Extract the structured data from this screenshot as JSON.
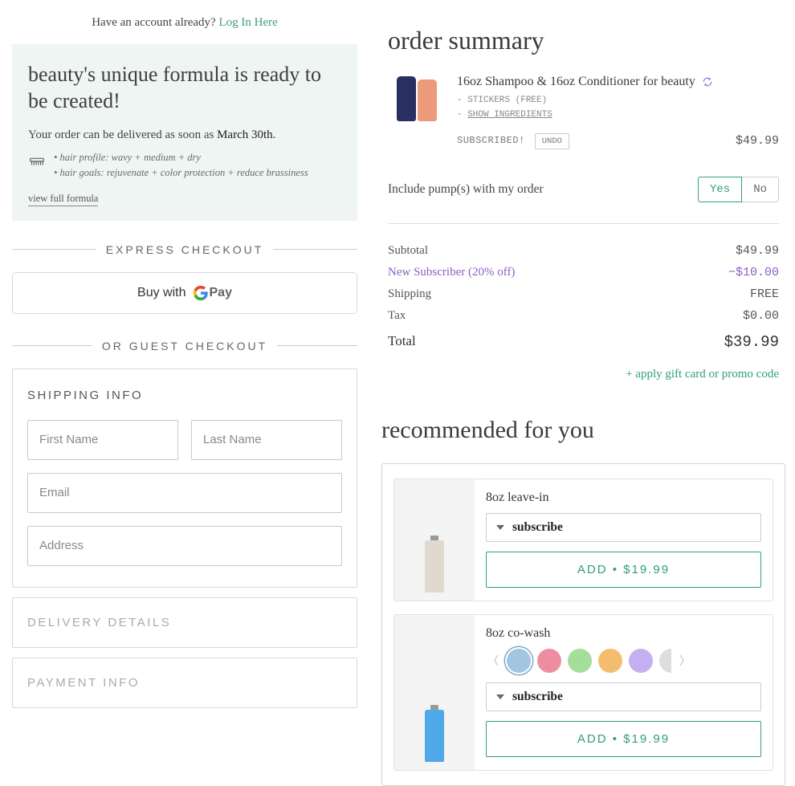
{
  "login": {
    "prompt": "Have an account already? ",
    "link": "Log In Here"
  },
  "formula": {
    "title": "beauty's unique formula is ready to be created!",
    "delivery_prefix": "Your order can be delivered as soon as ",
    "delivery_date": "March 30th",
    "delivery_suffix": ".",
    "profile_line": "• hair profile: wavy + medium + dry",
    "goals_line": "• hair goals: rejuvenate + color protection + reduce brassiness",
    "view_link": "view full formula"
  },
  "express": {
    "heading": "EXPRESS CHECKOUT",
    "buy_with": "Buy with ",
    "gpay": "Pay"
  },
  "guest": {
    "heading": "OR GUEST CHECKOUT"
  },
  "shipping": {
    "title": "SHIPPING INFO",
    "first_name_ph": "First Name",
    "last_name_ph": "Last Name",
    "email_ph": "Email",
    "address_ph": "Address"
  },
  "delivery_section": "DELIVERY DETAILS",
  "payment_section": "PAYMENT INFO",
  "order": {
    "title": "order summary",
    "product_name": "16oz Shampoo & 16oz Conditioner for beauty",
    "meta_stickers": "- STICKERS (FREE)",
    "meta_show_prefix": "- ",
    "meta_show": "SHOW INGREDIENTS",
    "subscribed": "SUBSCRIBED!",
    "undo": "UNDO",
    "line_price": "$49.99",
    "pump_label": "Include pump(s) with my order",
    "yes": "Yes",
    "no": "No",
    "subtotal_label": "Subtotal",
    "subtotal_val": "$49.99",
    "promo_label": "New Subscriber (20% off)",
    "promo_val": "−$10.00",
    "shipping_label": "Shipping",
    "shipping_val": "FREE",
    "tax_label": "Tax",
    "tax_val": "$0.00",
    "total_label": "Total",
    "total_val": "$39.99",
    "apply": "+ apply gift card or promo code"
  },
  "recommended": {
    "title": "recommended for you",
    "subscribe_label": "subscribe",
    "items": [
      {
        "name": "8oz leave-in",
        "add_label": "ADD • $19.99"
      },
      {
        "name": "8oz co-wash",
        "add_label": "ADD • $19.99"
      }
    ],
    "swatches": [
      "#a2c6e2",
      "#ef8da0",
      "#a5dd9b",
      "#f3bd6d",
      "#c4b0f0"
    ]
  }
}
